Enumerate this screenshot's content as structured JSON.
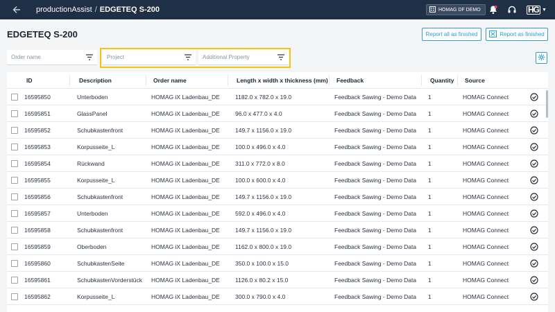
{
  "topbar": {
    "app_name": "productionAssist",
    "separator": "/",
    "current": "EDGETEQ S-200",
    "tenant": "HOMAG DF DEMO",
    "logo_text": "HG"
  },
  "page": {
    "title": "EDGETEQ S-200",
    "report_all_label": "Report all as finished",
    "report_label": "Report as finished"
  },
  "filters": {
    "order_name_placeholder": "Order name",
    "project_placeholder": "Project",
    "additional_property_placeholder": "Additional Property"
  },
  "colors": {
    "accent": "#2e9dcc",
    "topbar": "#1f2f45",
    "highlight": "#f2c40f"
  },
  "table": {
    "columns": {
      "id": "ID",
      "description": "Description",
      "order_name": "Order name",
      "dimensions": "Length x width x thickness (mm)",
      "feedback": "Feedback",
      "quantity": "Quantity",
      "source": "Source"
    },
    "rows": [
      {
        "id": "16595850",
        "description": "Unterboden",
        "order_name": "HOMAG iX Ladenbau_DE",
        "dimensions": "1182.0 x 782.0 x 19.0",
        "feedback": "Feedback Sawing - Demo Data",
        "quantity": "1",
        "source": "HOMAG Connect"
      },
      {
        "id": "16595851",
        "description": "GlassPanel",
        "order_name": "HOMAG iX Ladenbau_DE",
        "dimensions": "96.0 x 477.0 x 4.0",
        "feedback": "Feedback Sawing - Demo Data",
        "quantity": "1",
        "source": "HOMAG Connect"
      },
      {
        "id": "16595852",
        "description": "Schubkastenfront",
        "order_name": "HOMAG iX Ladenbau_DE",
        "dimensions": "149.7 x 1156.0 x 19.0",
        "feedback": "Feedback Sawing - Demo Data",
        "quantity": "1",
        "source": "HOMAG Connect"
      },
      {
        "id": "16595853",
        "description": "Korpusseite_L",
        "order_name": "HOMAG iX Ladenbau_DE",
        "dimensions": "100.0 x 496.0 x 4.0",
        "feedback": "Feedback Sawing - Demo Data",
        "quantity": "1",
        "source": "HOMAG Connect"
      },
      {
        "id": "16595854",
        "description": "Rückwand",
        "order_name": "HOMAG iX Ladenbau_DE",
        "dimensions": "311.0 x 772.0 x 8.0",
        "feedback": "Feedback Sawing - Demo Data",
        "quantity": "1",
        "source": "HOMAG Connect"
      },
      {
        "id": "16595855",
        "description": "Korpusseite_L",
        "order_name": "HOMAG iX Ladenbau_DE",
        "dimensions": "100.0 x 600.0 x 4.0",
        "feedback": "Feedback Sawing - Demo Data",
        "quantity": "1",
        "source": "HOMAG Connect"
      },
      {
        "id": "16595856",
        "description": "Schubkastenfront",
        "order_name": "HOMAG iX Ladenbau_DE",
        "dimensions": "149.7 x 1156.0 x 19.0",
        "feedback": "Feedback Sawing - Demo Data",
        "quantity": "1",
        "source": "HOMAG Connect"
      },
      {
        "id": "16595857",
        "description": "Unterboden",
        "order_name": "HOMAG iX Ladenbau_DE",
        "dimensions": "592.0 x 496.0 x 4.0",
        "feedback": "Feedback Sawing - Demo Data",
        "quantity": "1",
        "source": "HOMAG Connect"
      },
      {
        "id": "16595858",
        "description": "Schubkastenfront",
        "order_name": "HOMAG iX Ladenbau_DE",
        "dimensions": "149.7 x 1156.0 x 19.0",
        "feedback": "Feedback Sawing - Demo Data",
        "quantity": "1",
        "source": "HOMAG Connect"
      },
      {
        "id": "16595859",
        "description": "Oberboden",
        "order_name": "HOMAG iX Ladenbau_DE",
        "dimensions": "1162.0 x 800.0 x 19.0",
        "feedback": "Feedback Sawing - Demo Data",
        "quantity": "1",
        "source": "HOMAG Connect"
      },
      {
        "id": "16595860",
        "description": "SchubkastenSeite",
        "order_name": "HOMAG iX Ladenbau_DE",
        "dimensions": "350.0 x 100.0 x 15.0",
        "feedback": "Feedback Sawing - Demo Data",
        "quantity": "1",
        "source": "HOMAG Connect"
      },
      {
        "id": "16595861",
        "description": "SchubkastenVorderstück",
        "order_name": "HOMAG iX Ladenbau_DE",
        "dimensions": "1126.0 x 80.2 x 15.0",
        "feedback": "Feedback Sawing - Demo Data",
        "quantity": "1",
        "source": "HOMAG Connect"
      },
      {
        "id": "16595862",
        "description": "Korpusseite_L",
        "order_name": "HOMAG iX Ladenbau_DE",
        "dimensions": "300.0 x 790.0 x 4.0",
        "feedback": "Feedback Sawing - Demo Data",
        "quantity": "1",
        "source": "HOMAG Connect"
      }
    ]
  }
}
